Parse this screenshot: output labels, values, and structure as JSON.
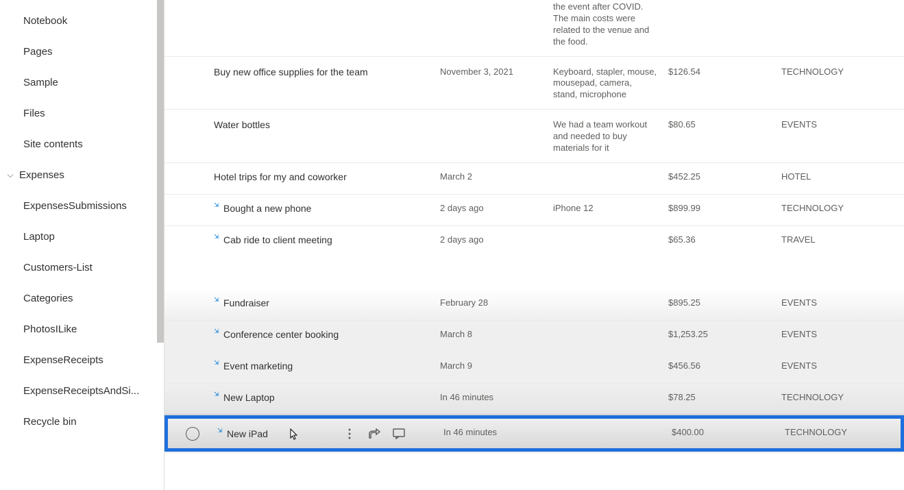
{
  "sidebar": {
    "items_top": [
      {
        "label": "Notebook"
      },
      {
        "label": "Pages"
      },
      {
        "label": "Sample"
      },
      {
        "label": "Files"
      },
      {
        "label": "Site contents"
      }
    ],
    "group": {
      "label": "Expenses"
    },
    "items_group": [
      {
        "label": "ExpensesSubmissions"
      },
      {
        "label": "Laptop"
      },
      {
        "label": "Customers-List"
      },
      {
        "label": "Categories"
      },
      {
        "label": "PhotosILike"
      },
      {
        "label": "ExpenseReceipts"
      },
      {
        "label": "ExpenseReceiptsAndSi..."
      },
      {
        "label": "Recycle bin"
      }
    ]
  },
  "previous_item_desc_tail": "the event after COVID. The main costs were related to the venue and the food.",
  "rows": [
    {
      "title": "Buy new office supplies for the team",
      "date": "November 3, 2021",
      "desc": "Keyboard, stapler, mouse, mousepad, camera, stand, microphone",
      "amount": "$126.54",
      "category": "TECHNOLOGY",
      "new": false
    },
    {
      "title": "Water bottles",
      "date": "",
      "desc": "We had a team workout and needed to buy materials for it",
      "amount": "$80.65",
      "category": "EVENTS",
      "new": false
    },
    {
      "title": "Hotel trips for my and coworker",
      "date": "March 2",
      "desc": "",
      "amount": "$452.25",
      "category": "HOTEL",
      "new": false
    },
    {
      "title": "Bought a new phone",
      "date": "2 days ago",
      "desc": "iPhone 12",
      "amount": "$899.99",
      "category": "TECHNOLOGY",
      "new": true
    },
    {
      "title": "Cab ride to client meeting",
      "date": "2 days ago",
      "desc": "",
      "amount": "$65.36",
      "category": "TRAVEL",
      "new": true
    },
    {
      "title": "Fundraiser",
      "date": "February 28",
      "desc": "",
      "amount": "$895.25",
      "category": "EVENTS",
      "new": true
    },
    {
      "title": "Conference center booking",
      "date": "March 8",
      "desc": "",
      "amount": "$1,253.25",
      "category": "EVENTS",
      "new": true
    },
    {
      "title": "Event marketing",
      "date": "March 9",
      "desc": "",
      "amount": "$456.56",
      "category": "EVENTS",
      "new": true
    },
    {
      "title": "New Laptop",
      "date": "In 46 minutes",
      "desc": "",
      "amount": "$78.25",
      "category": "TECHNOLOGY",
      "new": true
    },
    {
      "title": "New iPad",
      "date": "In 46 minutes",
      "desc": "",
      "amount": "$400.00",
      "category": "TECHNOLOGY",
      "new": true
    }
  ],
  "icons": {
    "chevron": "⌵",
    "new_marker": "⇲"
  }
}
